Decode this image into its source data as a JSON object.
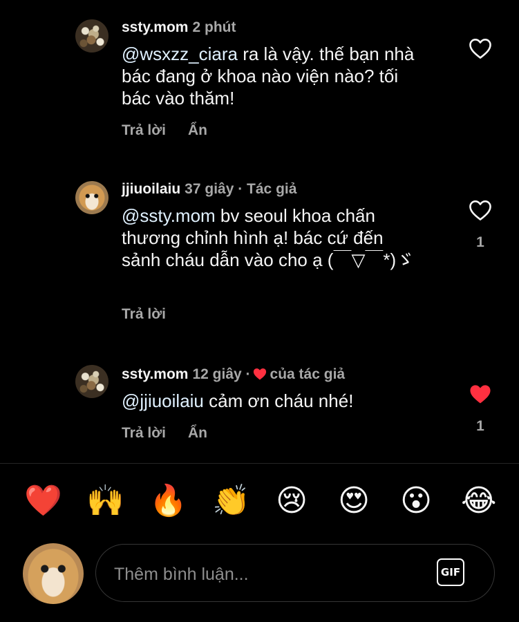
{
  "comments": [
    {
      "author": "ssty.mom",
      "time": "2 phút",
      "mention": "@wsxzz_ciara",
      "text": " ra là vậy. thế bạn nhà bác đang ở khoa nào viện nào? tối bác vào thăm!",
      "reply_label": "Trả lời",
      "hide_label": "Ẩn",
      "liked": false,
      "like_count": ""
    },
    {
      "author": "jjiuoilaiu",
      "time": "37 giây · Tác giả",
      "mention": "@ssty.mom",
      "text": " bv seoul khoa chấn thương chỉnh hình ạ! bác cứ đến sảnh cháu dẫn vào cho ạ (￣▽￣*)ゞ",
      "reply_label": "Trả lời",
      "liked": false,
      "like_count": "1"
    },
    {
      "author": "ssty.mom",
      "time": "12 giây ·",
      "liked_by_author": "của tác giả",
      "mention": "@jjiuoilaiu",
      "text": " cảm ơn cháu nhé!",
      "reply_label": "Trả lời",
      "hide_label": "Ẩn",
      "liked": true,
      "like_count": "1"
    }
  ],
  "reactions": [
    "❤️",
    "🙌",
    "🔥",
    "👏",
    "😢",
    "😍",
    "😮",
    "😂"
  ],
  "composer": {
    "placeholder": "Thêm bình luận...",
    "gif_label": "GIF"
  },
  "colors": {
    "background": "#000000",
    "text": "#f5f5f5",
    "secondary": "#a8a8a8",
    "like_red": "#ff3040"
  }
}
